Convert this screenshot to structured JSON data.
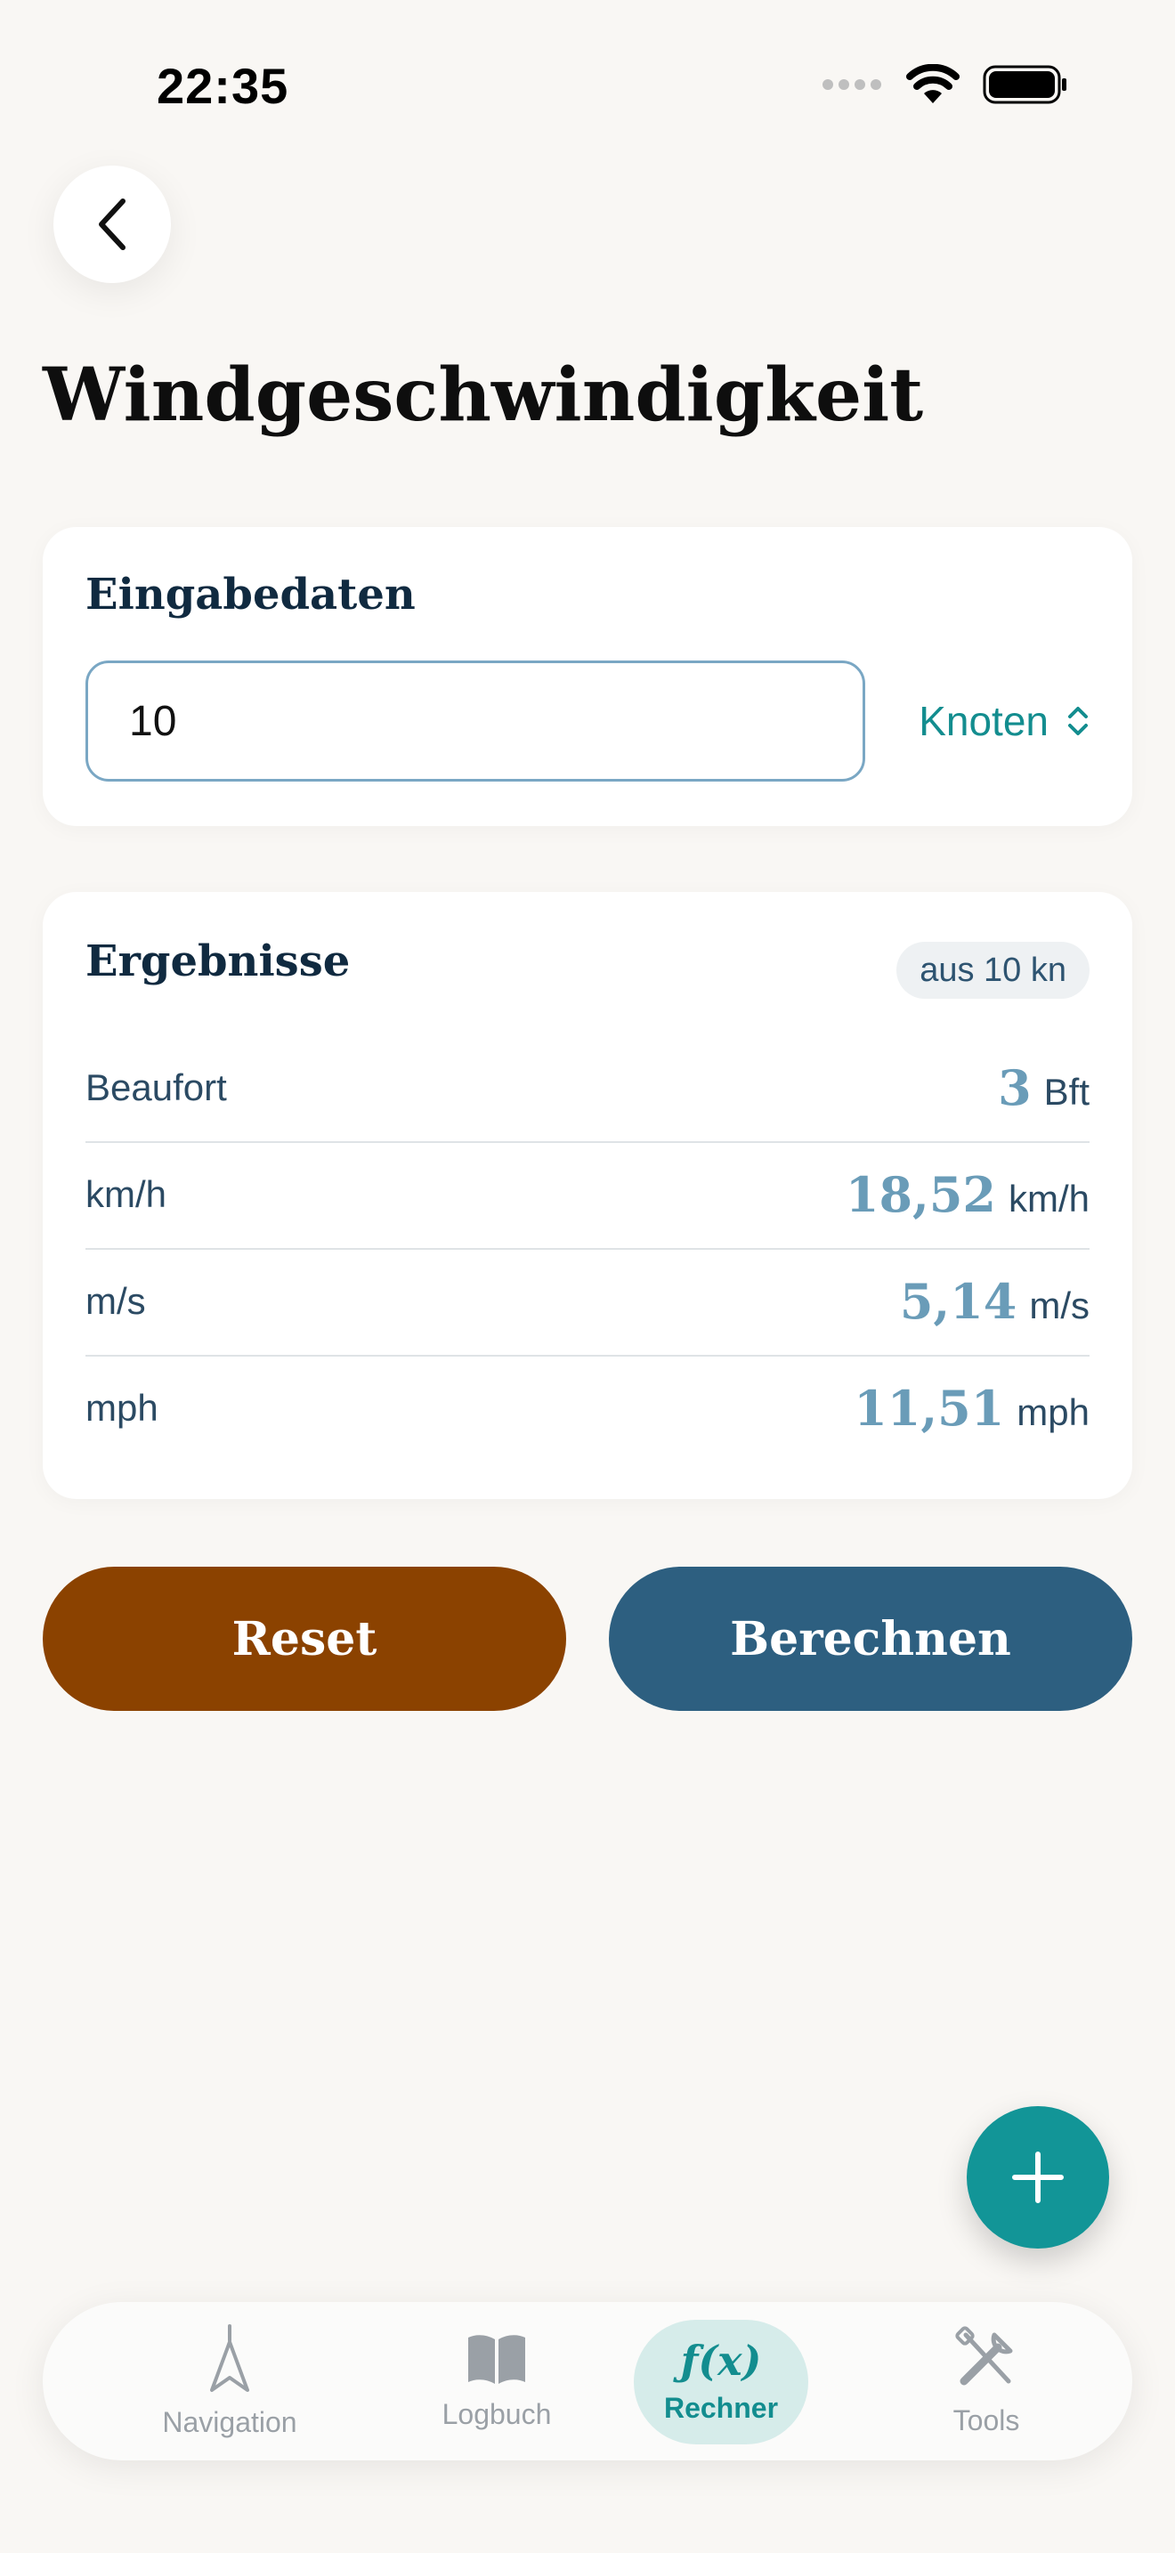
{
  "status_bar": {
    "time": "22:35"
  },
  "header": {
    "title": "Windgeschwindigkeit"
  },
  "input_card": {
    "heading": "Eingabedaten",
    "value": "10",
    "unit": "Knoten"
  },
  "results_card": {
    "heading": "Ergebnisse",
    "badge": "aus 10 kn",
    "rows": [
      {
        "label": "Beaufort",
        "value": "3",
        "unit": "Bft"
      },
      {
        "label": "km/h",
        "value": "18,52",
        "unit": "km/h"
      },
      {
        "label": "m/s",
        "value": "5,14",
        "unit": "m/s"
      },
      {
        "label": "mph",
        "value": "11,51",
        "unit": "mph"
      }
    ]
  },
  "actions": {
    "reset_label": "Reset",
    "calculate_label": "Berechnen"
  },
  "tab_bar": {
    "tabs": [
      {
        "label": "Navigation",
        "icon": "navigation-icon"
      },
      {
        "label": "Logbuch",
        "icon": "book-icon"
      },
      {
        "label": "Rechner",
        "icon": "function-icon",
        "glyph": "ƒ(x)",
        "active": true
      },
      {
        "label": "Tools",
        "icon": "tools-icon"
      }
    ]
  },
  "colors": {
    "accent_teal": "#129597",
    "reset_brown": "#8b4200",
    "calculate_blue": "#2d5f80",
    "result_value": "#6a9cb8"
  }
}
